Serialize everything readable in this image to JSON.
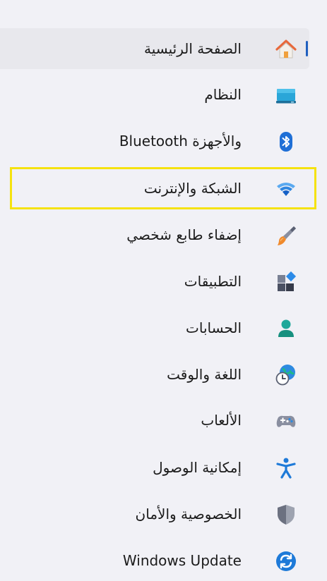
{
  "nav": {
    "items": [
      {
        "label": "الصفحة الرئيسية",
        "icon": "home-icon",
        "selected": true
      },
      {
        "label": "النظام",
        "icon": "system-monitor-icon"
      },
      {
        "label": "والأجهزة Bluetooth",
        "icon": "bluetooth-icon"
      },
      {
        "label": "الشبكة والإنترنت",
        "icon": "wifi-icon",
        "highlighted": true
      },
      {
        "label": "إضفاء طابع شخصي",
        "icon": "paintbrush-icon"
      },
      {
        "label": "التطبيقات",
        "icon": "apps-icon"
      },
      {
        "label": "الحسابات",
        "icon": "person-icon"
      },
      {
        "label": "اللغة والوقت",
        "icon": "globe-clock-icon"
      },
      {
        "label": "الألعاب",
        "icon": "gamepad-icon"
      },
      {
        "label": "إمكانية الوصول",
        "icon": "accessibility-icon"
      },
      {
        "label": "الخصوصية والأمان",
        "icon": "shield-icon"
      },
      {
        "label": "Windows Update",
        "icon": "windows-update-icon"
      }
    ]
  },
  "colors": {
    "accent": "#1f5fbf",
    "highlight_border": "#f5e20f",
    "background": "#f1f1f6",
    "selected_bg": "#e8e8ed"
  }
}
